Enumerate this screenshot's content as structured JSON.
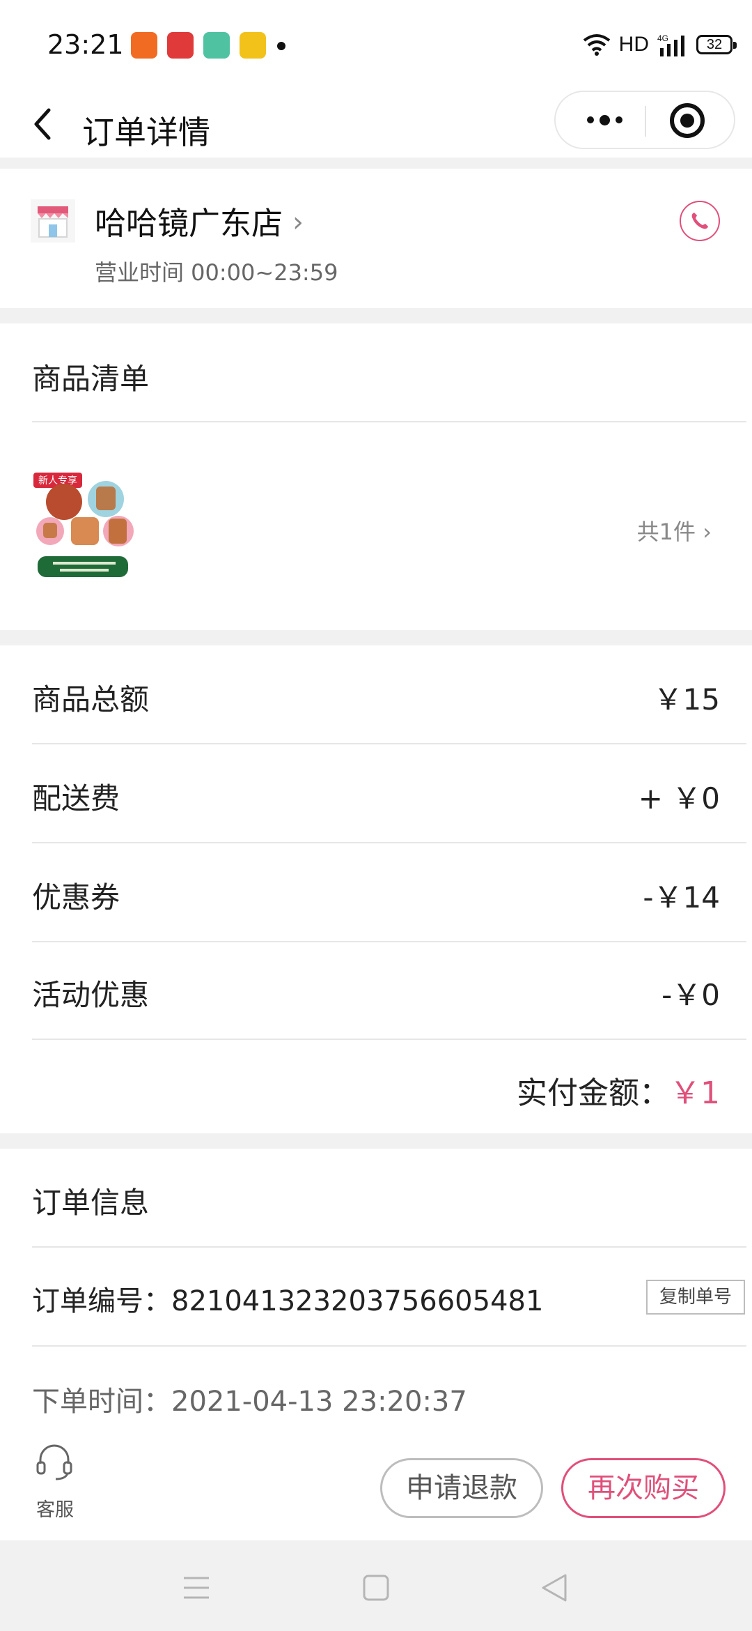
{
  "status_bar": {
    "time": "23:21",
    "network": "HD",
    "battery": "32",
    "app_icons": [
      {
        "name": "kuaishou-icon",
        "color": "#f26b23"
      },
      {
        "name": "netease-music-icon",
        "color": "#e03a3a"
      },
      {
        "name": "book-app-icon",
        "color": "#4fc3a1"
      },
      {
        "name": "note-app-icon",
        "color": "#f2c21b"
      }
    ]
  },
  "nav": {
    "title": "订单详情"
  },
  "store": {
    "name": "哈哈镜广东店",
    "hours": "营业时间 00:00~23:59"
  },
  "products": {
    "title": "商品清单",
    "badge": "新人专享",
    "count_label": "共1件"
  },
  "amounts": {
    "rows": [
      {
        "label": "商品总额",
        "value": "￥15"
      },
      {
        "label": "配送费",
        "value": "+ ￥0"
      },
      {
        "label": "优惠券",
        "value": "-￥14"
      },
      {
        "label": "活动优惠",
        "value": "-￥0"
      }
    ],
    "total_label": "实付金额：",
    "total_value": "￥1"
  },
  "order_info": {
    "title": "订单信息",
    "number_text": "订单编号：8210413232037566054­81",
    "copy_label": "复制单号",
    "time_text": "下单时间：2021-04-13 23:20:37"
  },
  "actions": {
    "service_label": "客服",
    "refund_label": "申请退款",
    "rebuy_label": "再次购买"
  },
  "colors": {
    "accent": "#e0507a",
    "background": "#f1f1f1"
  }
}
